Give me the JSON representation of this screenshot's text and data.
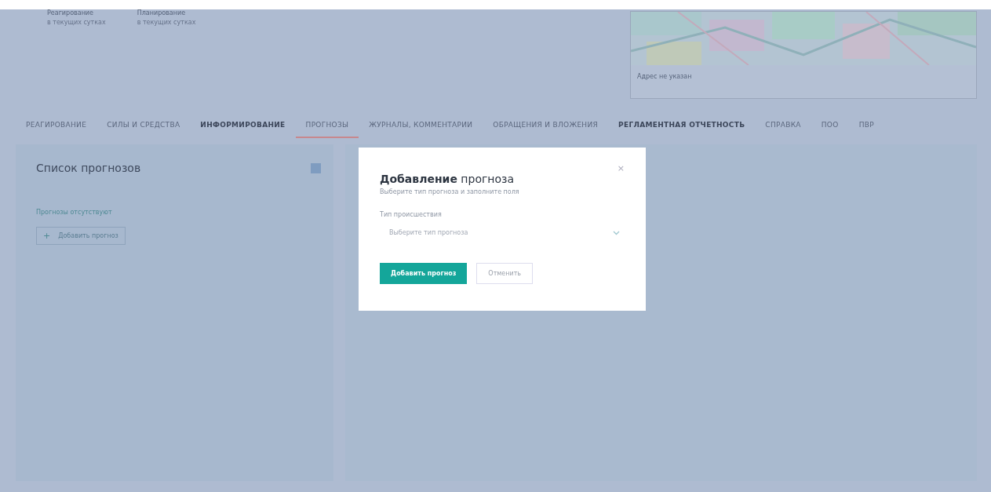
{
  "header": {
    "stats": [
      {
        "title": "Реагирование",
        "caption": "в текущих сутках"
      },
      {
        "title": "Планирование",
        "caption": "в текущих сутках"
      }
    ],
    "map": {
      "kind": "picture",
      "caption": "Адрес не указан"
    }
  },
  "tabs": [
    {
      "label": "РЕАГИРОВАНИЕ",
      "selected": false,
      "bold": false
    },
    {
      "label": "СИЛЫ И СРЕДСТВА",
      "selected": false,
      "bold": false
    },
    {
      "label": "ИНФОРМИРОВАНИЕ",
      "selected": false,
      "bold": true
    },
    {
      "label": "ПРОГНОЗЫ",
      "selected": true,
      "bold": false
    },
    {
      "label": "ЖУРНАЛЫ, КОММЕНТАРИИ",
      "selected": false,
      "bold": false
    },
    {
      "label": "ОБРАЩЕНИЯ И ВЛОЖЕНИЯ",
      "selected": false,
      "bold": false
    },
    {
      "label": "РЕГЛАМЕНТНАЯ ОТЧЕТНОСТЬ",
      "selected": false,
      "bold": true
    },
    {
      "label": "СПРАВКА",
      "selected": false,
      "bold": false
    },
    {
      "label": "ПОО",
      "selected": false,
      "bold": false
    },
    {
      "label": "ПВР",
      "selected": false,
      "bold": false
    }
  ],
  "forecast_list": {
    "title": "Список прогнозов",
    "empty_text": "Прогнозы отсутствуют",
    "add_button": "Добавить прогноз",
    "add_icon": "+"
  },
  "dialog": {
    "title": "**Добавление** прогноза",
    "subtitle": "Выберите тип прогноза и заполните поля",
    "close": "×",
    "field_label": "Тип происшествия",
    "select_placeholder": "Выберите тип прогноза",
    "submit": "Добавить прогноз",
    "cancel": "Отменить"
  }
}
